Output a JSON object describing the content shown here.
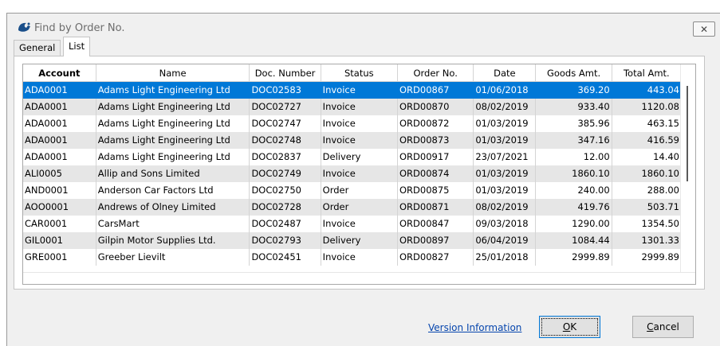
{
  "window": {
    "title": "Find by Order No.",
    "close_glyph": "✕",
    "icon": "app-logo-icon"
  },
  "tabs": [
    {
      "label": "General",
      "active": false
    },
    {
      "label": "List",
      "active": true
    }
  ],
  "grid": {
    "columns": [
      "Account",
      "Name",
      "Doc. Number",
      "Status",
      "Order No.",
      "Date",
      "Goods Amt.",
      "Total Amt."
    ],
    "rows": [
      [
        "ADA0001",
        "Adams Light Engineering Ltd",
        "DOC02583",
        "Invoice",
        "ORD00867",
        "01/06/2018",
        "369.20",
        "443.04"
      ],
      [
        "ADA0001",
        "Adams Light Engineering Ltd",
        "DOC02727",
        "Invoice",
        "ORD00870",
        "08/02/2019",
        "933.40",
        "1120.08"
      ],
      [
        "ADA0001",
        "Adams Light Engineering Ltd",
        "DOC02747",
        "Invoice",
        "ORD00872",
        "01/03/2019",
        "385.96",
        "463.15"
      ],
      [
        "ADA0001",
        "Adams Light Engineering Ltd",
        "DOC02748",
        "Invoice",
        "ORD00873",
        "01/03/2019",
        "347.16",
        "416.59"
      ],
      [
        "ADA0001",
        "Adams Light Engineering Ltd",
        "DOC02837",
        "Delivery",
        "ORD00917",
        "23/07/2021",
        "12.00",
        "14.40"
      ],
      [
        "ALI0005",
        "Allip and Sons Limited",
        "DOC02749",
        "Invoice",
        "ORD00874",
        "01/03/2019",
        "1860.10",
        "1860.10"
      ],
      [
        "AND0001",
        "Anderson Car Factors Ltd",
        "DOC02750",
        "Order",
        "ORD00875",
        "01/03/2019",
        "240.00",
        "288.00"
      ],
      [
        "AOO0001",
        "Andrews of Olney Limited",
        "DOC02728",
        "Order",
        "ORD00871",
        "08/02/2019",
        "419.76",
        "503.71"
      ],
      [
        "CAR0001",
        "CarsMart",
        "DOC02487",
        "Invoice",
        "ORD00847",
        "09/03/2018",
        "1290.00",
        "1354.50"
      ],
      [
        "GIL0001",
        "Gilpin Motor Supplies Ltd.",
        "DOC02793",
        "Delivery",
        "ORD00897",
        "06/04/2019",
        "1084.44",
        "1301.33"
      ],
      [
        "GRE0001",
        "Greeber Lievilt",
        "DOC02451",
        "Invoice",
        "ORD00827",
        "25/01/2018",
        "2999.89",
        "2999.89"
      ]
    ],
    "selected_row": 0
  },
  "footer": {
    "version_link": "Version Information",
    "ok_label": "OK",
    "ok_underline": "O",
    "ok_rest": "K",
    "cancel_label": "Cancel",
    "cancel_underline": "C",
    "cancel_rest": "ancel"
  },
  "colors": {
    "selection": "#0078d7",
    "alt_row": "#e6e6e6",
    "link": "#0645ad"
  }
}
